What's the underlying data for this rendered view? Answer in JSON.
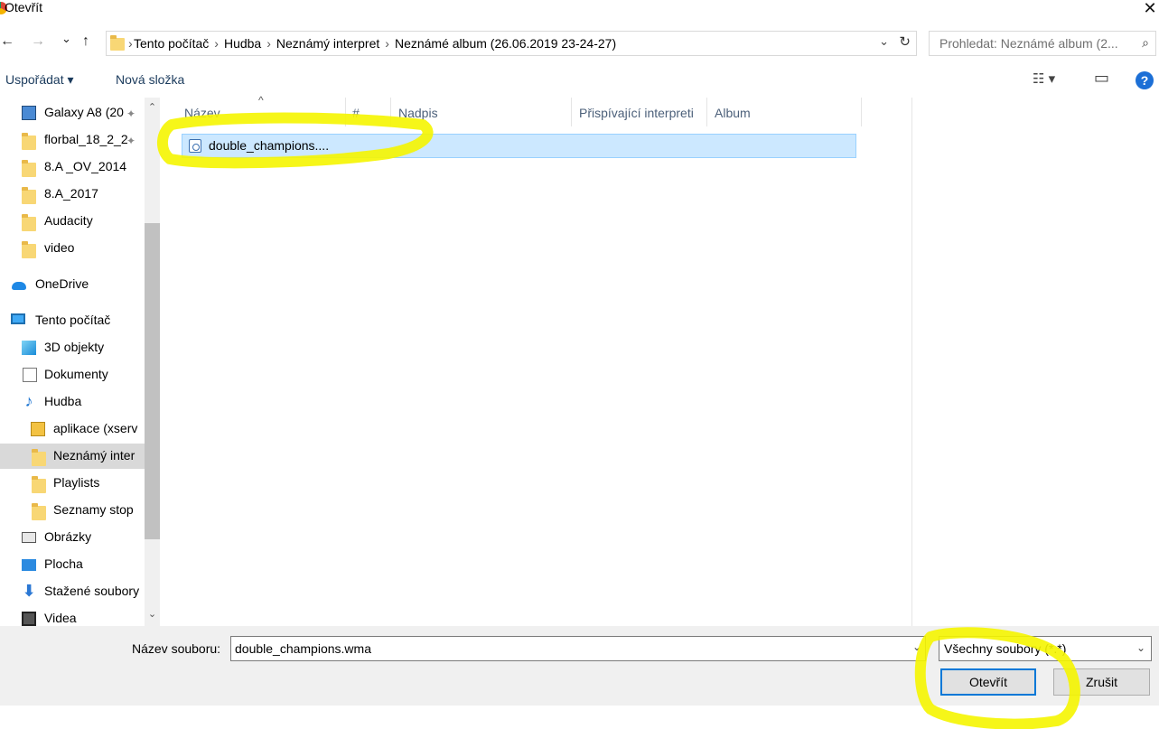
{
  "window": {
    "title": "Otevřít",
    "close_glyph": "✕"
  },
  "nav": {
    "back": "←",
    "forward": "→",
    "recent": "⌄",
    "up": "↑"
  },
  "address": {
    "crumbs": [
      "Tento počítač",
      "Hudba",
      "Neznámý interpret",
      "Neznámé album (26.06.2019 23-24-27)"
    ],
    "separator": "›",
    "dropdown_glyph": "⌄",
    "refresh_glyph": "↻"
  },
  "search": {
    "placeholder": "Prohledat: Neznámé album (2...",
    "icon": "⌕"
  },
  "toolbar": {
    "organize": "Uspořádat ▾",
    "new_folder": "Nová složka",
    "view_glyph": "☷ ▾",
    "pane_glyph": "▭",
    "help": "?"
  },
  "sidebar": {
    "items": [
      {
        "label": "Galaxy A8 (20",
        "icon": "phone-icon",
        "pinned": true
      },
      {
        "label": "florbal_18_2_2",
        "icon": "folder-icon",
        "pinned": true
      },
      {
        "label": "8.A _OV_2014",
        "icon": "folder-icon"
      },
      {
        "label": "8.A_2017",
        "icon": "folder-icon"
      },
      {
        "label": "Audacity",
        "icon": "folder-icon"
      },
      {
        "label": "video",
        "icon": "folder-icon"
      },
      {
        "label": "OneDrive",
        "icon": "cloud-icon"
      },
      {
        "label": "Tento počítač",
        "icon": "computer-icon"
      },
      {
        "label": "3D objekty",
        "icon": "cube-icon"
      },
      {
        "label": "Dokumenty",
        "icon": "document-icon"
      },
      {
        "label": "Hudba",
        "icon": "music-icon"
      },
      {
        "label": "aplikace (xserv",
        "icon": "app-icon"
      },
      {
        "label": "Neznámý inter",
        "icon": "folder-icon",
        "selected": true
      },
      {
        "label": "Playlists",
        "icon": "folder-icon"
      },
      {
        "label": "Seznamy stop",
        "icon": "folder-icon"
      },
      {
        "label": "Obrázky",
        "icon": "pictures-icon"
      },
      {
        "label": "Plocha",
        "icon": "desktop-icon"
      },
      {
        "label": "Stažené soubory",
        "icon": "download-icon"
      },
      {
        "label": "Videa",
        "icon": "video-icon"
      }
    ],
    "pin_glyph": "✦",
    "scroll_up": "⌃",
    "scroll_down": "⌄"
  },
  "columns": [
    "Název",
    "#",
    "Nadpis",
    "Přispívající interpreti",
    "Album"
  ],
  "sort_glyph": "^",
  "files": [
    {
      "name": "double_champions...."
    }
  ],
  "bottom": {
    "filename_label": "Název souboru:",
    "filename_value": "double_champions.wma",
    "filetype_value": "Všechny soubory (*.*)",
    "dropdown_glyph": "⌄",
    "open_label": "Otevřít",
    "cancel_label": "Zrušit"
  },
  "colors": {
    "highlight": "#f5f500",
    "selection": "#cce8ff",
    "accent": "#0078d7"
  }
}
